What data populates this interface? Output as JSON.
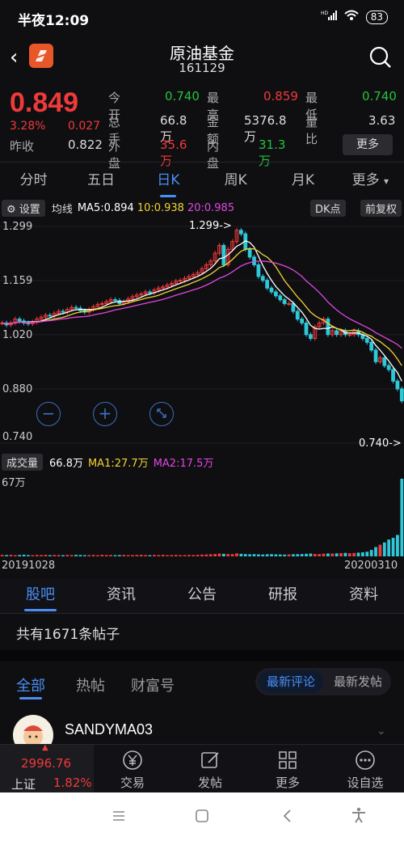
{
  "status_bar": {
    "time": "半夜12:09",
    "network": "HD",
    "battery": "83"
  },
  "header": {
    "title": "原油基金",
    "code": "161129"
  },
  "quote": {
    "price": "0.849",
    "change_pct": "3.28%",
    "change": "0.027",
    "prev_close_label": "昨收",
    "prev_close": "0.822",
    "rows": [
      [
        {
          "label": "今开",
          "value": "0.740",
          "color": "green"
        },
        {
          "label": "最高",
          "value": "0.859",
          "color": "red"
        },
        {
          "label": "最低",
          "value": "0.740",
          "color": "green"
        }
      ],
      [
        {
          "label": "总手",
          "value": "66.8万",
          "color": "white"
        },
        {
          "label": "金额",
          "value": "5376.8万",
          "color": "white"
        },
        {
          "label": "量比",
          "value": "3.63",
          "color": "white"
        }
      ],
      [
        {
          "label": "外盘",
          "value": "35.6万",
          "color": "red"
        },
        {
          "label": "内盘",
          "value": "31.3万",
          "color": "green"
        }
      ]
    ],
    "more_label": "更多"
  },
  "period_tabs": [
    "分时",
    "五日",
    "日K",
    "周K",
    "月K",
    "更多"
  ],
  "active_period": "日K",
  "ma_bar": {
    "settings_label": "设置",
    "title": "均线",
    "ma5": "MA5:0.894",
    "ma10": "10:0.938",
    "ma20": "20:0.985",
    "dk_label": "DK点",
    "adjust_label": "前复权"
  },
  "volume_bar": {
    "label": "成交量",
    "value": "66.8万",
    "ma1": "MA1:27.7万",
    "ma2": "MA2:17.5万"
  },
  "chart_data": {
    "type": "candlestick",
    "price_axis_labels": [
      "1.299",
      "1.159",
      "1.020",
      "0.880",
      "0.740"
    ],
    "ylim": [
      0.74,
      1.299
    ],
    "max_annotation": "1.299->",
    "min_annotation": "0.740->",
    "volume_axis_label": "67万",
    "x_start": "20191028",
    "x_end": "20200310",
    "close": [
      1.05,
      1.045,
      1.05,
      1.06,
      1.055,
      1.05,
      1.048,
      1.052,
      1.06,
      1.065,
      1.07,
      1.068,
      1.075,
      1.08,
      1.078,
      1.085,
      1.09,
      1.088,
      1.082,
      1.078,
      1.085,
      1.092,
      1.098,
      1.1,
      1.105,
      1.11,
      1.108,
      1.1,
      1.105,
      1.112,
      1.118,
      1.122,
      1.125,
      1.13,
      1.128,
      1.135,
      1.14,
      1.143,
      1.148,
      1.152,
      1.158,
      1.16,
      1.165,
      1.17,
      1.175,
      1.18,
      1.19,
      1.2,
      1.21,
      1.23,
      1.25,
      1.2,
      1.24,
      1.26,
      1.289,
      1.28,
      1.24,
      1.22,
      1.2,
      1.17,
      1.16,
      1.14,
      1.13,
      1.12,
      1.11,
      1.1,
      1.1,
      1.08,
      1.06,
      1.05,
      1.02,
      1.01,
      1.04,
      1.05,
      1.06,
      1.02,
      1.03,
      1.02,
      1.03,
      1.02,
      1.02,
      1.03,
      1.02,
      1.01,
      1.0,
      0.98,
      0.95,
      0.96,
      0.94,
      0.93,
      0.9,
      0.88,
      0.849
    ],
    "volume": [
      1.2,
      1.1,
      1.3,
      1.0,
      1.2,
      1.4,
      1.1,
      1.0,
      1.2,
      1.1,
      1.3,
      1.0,
      1.2,
      1.1,
      1.0,
      1.2,
      1.1,
      1.3,
      1.2,
      1.0,
      1.1,
      1.2,
      1.0,
      1.3,
      1.1,
      1.2,
      1.0,
      1.1,
      1.2,
      1.0,
      1.1,
      1.2,
      1.3,
      1.1,
      1.0,
      1.2,
      1.1,
      1.3,
      1.0,
      1.1,
      1.2,
      1.0,
      1.1,
      1.2,
      1.1,
      1.3,
      1.5,
      1.6,
      1.8,
      2.0,
      2.4,
      2.2,
      2.0,
      1.9,
      2.6,
      2.2,
      2.0,
      1.8,
      1.9,
      1.7,
      1.6,
      1.8,
      1.9,
      1.7,
      1.6,
      1.5,
      1.7,
      1.8,
      1.9,
      2.0,
      2.2,
      2.4,
      2.1,
      2.0,
      2.3,
      2.5,
      2.4,
      2.6,
      2.8,
      3.0,
      2.7,
      2.9,
      3.2,
      3.5,
      4.0,
      5.5,
      8.0,
      10.0,
      12.0,
      14.5,
      16.0,
      18.5,
      67.0
    ],
    "ma_colors": {
      "ma5": "#ffffff",
      "ma10": "#f2d335",
      "ma20": "#e047e0"
    }
  },
  "chart_controls": [
    "minus-icon",
    "plus-icon",
    "expand-icon"
  ],
  "sub_tabs": [
    "股吧",
    "资讯",
    "公告",
    "研报",
    "资料"
  ],
  "active_sub_tab": "股吧",
  "posts_count": "共有1671条帖子",
  "feed_tabs": [
    "全部",
    "热帖",
    "财富号"
  ],
  "active_feed_tab": "全部",
  "sort_options": [
    "最新评论",
    "最新发帖"
  ],
  "post": {
    "username": "SANDYMA03"
  },
  "bottom_nav": {
    "index_value": "2996.76",
    "index_name": "上证",
    "index_pct": "1.82%",
    "items": [
      {
        "label": "交易",
        "icon": "yen-icon"
      },
      {
        "label": "发帖",
        "icon": "edit-icon"
      },
      {
        "label": "更多",
        "icon": "grid-icon"
      },
      {
        "label": "设自选",
        "icon": "dots-icon"
      }
    ]
  }
}
